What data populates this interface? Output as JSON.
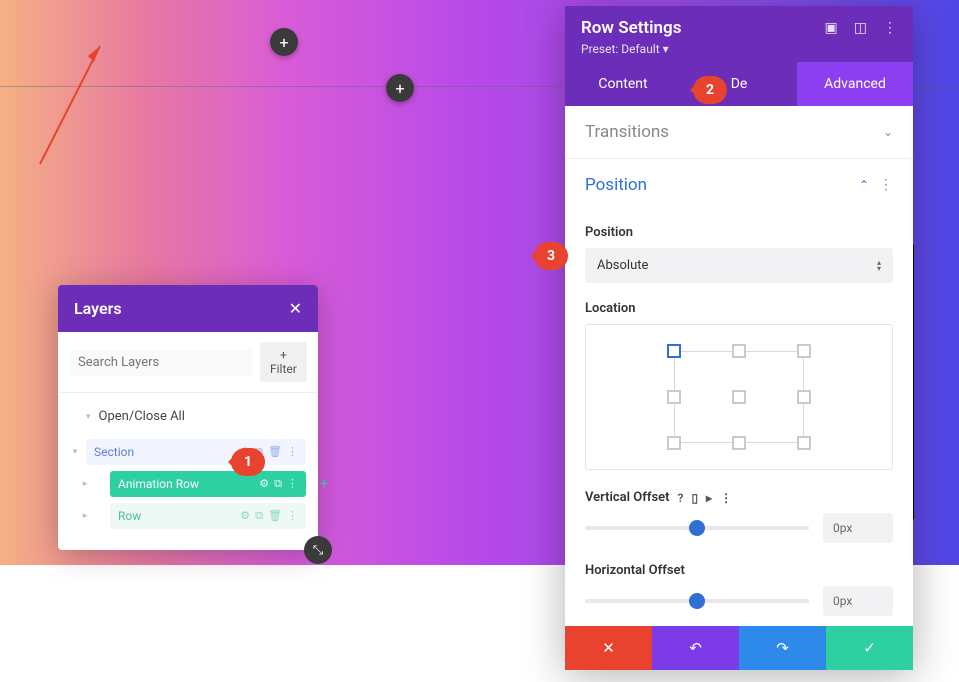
{
  "layers": {
    "title": "Layers",
    "search_placeholder": "Search Layers",
    "filter_label": "+ Filter",
    "open_close_all": "Open/Close All",
    "items": [
      {
        "label": "Section",
        "type": "section"
      },
      {
        "label": "Animation Row",
        "type": "row",
        "active": true
      },
      {
        "label": "Row",
        "type": "row"
      }
    ]
  },
  "settings": {
    "title": "Row Settings",
    "preset": "Preset: Default ▾",
    "tabs": {
      "content": "Content",
      "design": "De",
      "advanced": "Advanced"
    },
    "transitions_title": "Transitions",
    "position": {
      "title": "Position",
      "position_label": "Position",
      "position_value": "Absolute",
      "location_label": "Location",
      "vertical_label": "Vertical Offset",
      "vertical_value": "0px",
      "horizontal_label": "Horizontal Offset",
      "horizontal_value": "0px"
    }
  },
  "callouts": {
    "c1": "1",
    "c2": "2",
    "c3": "3"
  }
}
